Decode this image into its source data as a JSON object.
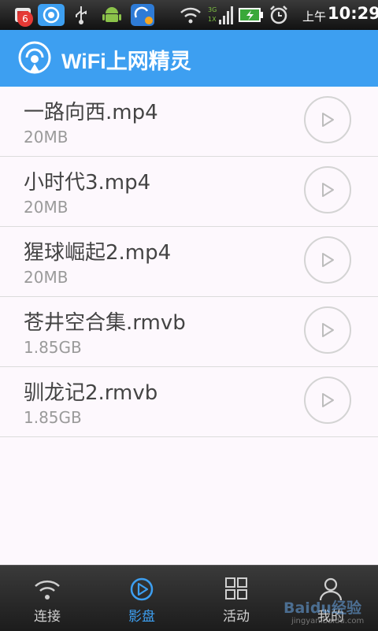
{
  "status_bar": {
    "notification_count": "6",
    "ampm": "上午",
    "time": "10:29",
    "network_label_top": "3G",
    "network_label_bottom": "1X",
    "icons": [
      "notification-app-icon",
      "wifi-app-icon",
      "usb-icon",
      "android-icon",
      "sync-app-icon",
      "wifi-signal-icon",
      "network-signal-icon",
      "battery-charging-icon",
      "alarm-clock-icon"
    ]
  },
  "app_bar": {
    "title": "WiFi上网精灵",
    "logo": "wifi-logo-icon",
    "color": "#3d9ff1"
  },
  "files": [
    {
      "name": "一路向西.mp4",
      "size": "20MB"
    },
    {
      "name": "小时代3.mp4",
      "size": "20MB"
    },
    {
      "name": "猩球崛起2.mp4",
      "size": "20MB"
    },
    {
      "name": "苍井空合集.rmvb",
      "size": "1.85GB"
    },
    {
      "name": "驯龙记2.rmvb",
      "size": "1.85GB"
    }
  ],
  "bottom_nav": [
    {
      "label": "连接",
      "icon": "wifi-icon",
      "active": false
    },
    {
      "label": "影盘",
      "icon": "play-circle-icon",
      "active": true
    },
    {
      "label": "活动",
      "icon": "grid-icon",
      "active": false
    },
    {
      "label": "我的",
      "icon": "user-icon",
      "active": false
    }
  ],
  "watermark": {
    "brand": "Baidu经验",
    "url": "jingyan.baidu.com"
  }
}
